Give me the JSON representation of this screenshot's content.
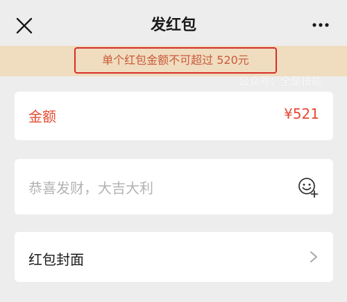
{
  "header": {
    "title": "发红包",
    "close_icon": "close-icon",
    "more_icon": "more-icon"
  },
  "alert": {
    "text": "单个红包金额不可超过 520元",
    "border_color": "#d42d26",
    "background": "#f0dcbf"
  },
  "watermark": {
    "text": "公众号：全是技能"
  },
  "amount": {
    "label": "金额",
    "value": "¥521",
    "color": "#e44a30"
  },
  "message": {
    "placeholder": "恭喜发财，大吉大利",
    "emoji_icon": "emoji-add-icon"
  },
  "cover": {
    "label": "红包封面",
    "chevron_icon": "chevron-right-icon"
  }
}
